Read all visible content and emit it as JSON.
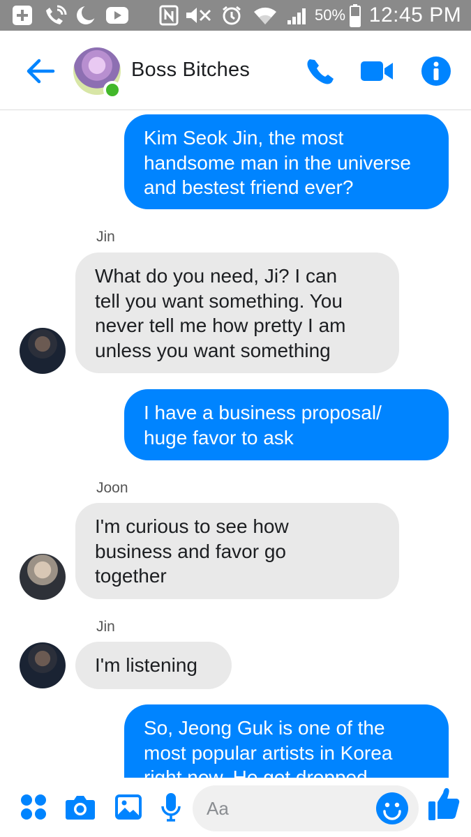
{
  "status_bar": {
    "battery_percent": "50%",
    "time": "12:45 PM",
    "icons": [
      "add-icon",
      "wifi-call-icon",
      "moon-icon",
      "youtube-icon",
      "nfc-icon",
      "mute-icon",
      "alarm-icon",
      "wifi-icon",
      "signal-icon",
      "battery-icon"
    ]
  },
  "header": {
    "chat_title": "Boss Bitches",
    "online": true,
    "actions": [
      "phone-icon",
      "video-icon",
      "info-icon"
    ],
    "accent_color": "#0084ff"
  },
  "messages": [
    {
      "direction": "outgoing",
      "text": "Kim Seok Jin, the most\nhandsome man in the universe\nand bestest friend ever?"
    },
    {
      "direction": "incoming",
      "sender": "Jin",
      "text": "What do you need, Ji? I can\ntell you want something. You\nnever tell me how pretty I am\nunless you want something"
    },
    {
      "direction": "outgoing",
      "text": "I have a business proposal/\nhuge favor to ask"
    },
    {
      "direction": "incoming",
      "sender": "Joon",
      "text": "I'm curious to see how\nbusiness and favor go\ntogether"
    },
    {
      "direction": "incoming",
      "sender": "Jin",
      "text": "I'm listening"
    },
    {
      "direction": "outgoing",
      "text": "So, Jeong Guk is one of the\nmost popular artists in Korea\nright now. He got dropped"
    }
  ],
  "composer": {
    "placeholder": "Aa",
    "value": "",
    "icons": [
      "apps-icon",
      "camera-icon",
      "gallery-icon",
      "microphone-icon",
      "emoji-icon",
      "thumbs-up-icon"
    ]
  },
  "colors": {
    "outgoing_bubble": "#0084ff",
    "incoming_bubble": "#e9e9e9",
    "status_bar": "#8a8a8a"
  }
}
